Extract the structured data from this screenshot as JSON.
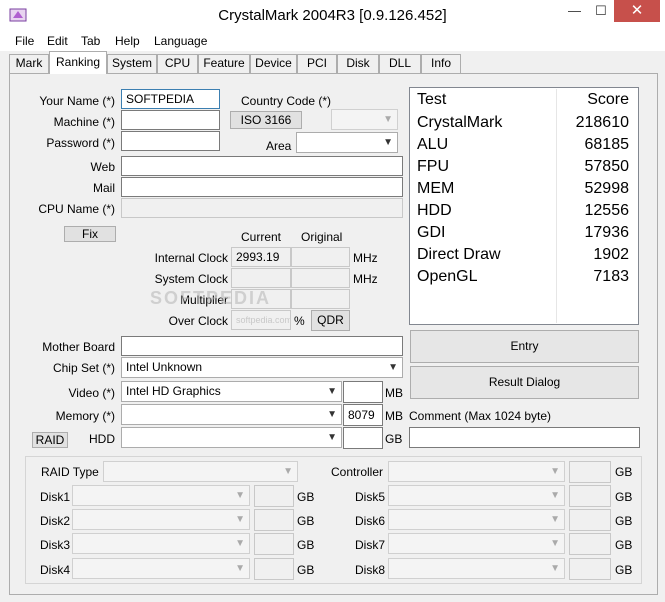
{
  "window": {
    "title": "CrystalMark 2004R3 [0.9.126.452]",
    "min_glyph": "—",
    "max_glyph": "☐",
    "close_glyph": "✕"
  },
  "menu": [
    "File",
    "Edit",
    "Tab",
    "Help",
    "Language"
  ],
  "tabs": [
    "Mark",
    "Ranking",
    "System",
    "CPU",
    "Feature",
    "Device",
    "PCI",
    "Disk",
    "DLL",
    "Info"
  ],
  "active_tab": "Ranking",
  "form": {
    "your_name_label": "Your Name (*)",
    "your_name_value": "SOFTPEDIA",
    "machine_label": "Machine (*)",
    "password_label": "Password (*)",
    "country_code_label": "Country Code (*)",
    "iso_button": "ISO 3166",
    "area_label": "Area",
    "web_label": "Web",
    "mail_label": "Mail",
    "cpu_name_label": "CPU Name (*)",
    "fix_button": "Fix",
    "current_label": "Current",
    "original_label": "Original",
    "internal_clock_label": "Internal Clock",
    "internal_clock_value": "2993.19",
    "system_clock_label": "System Clock",
    "multiplier_label": "Multiplier",
    "over_clock_label": "Over Clock",
    "mhz1": "MHz",
    "mhz2": "MHz",
    "percent": "%",
    "qdr_button": "QDR",
    "mother_board_label": "Mother Board",
    "chip_set_label": "Chip Set (*)",
    "chip_set_value": "Intel Unknown",
    "video_label": "Video (*)",
    "video_value": "Intel HD Graphics",
    "video_unit": "MB",
    "memory_label": "Memory (*)",
    "memory_value": "8079",
    "memory_unit": "MB",
    "raid_button": "RAID",
    "hdd_label": "HDD",
    "hdd_unit": "GB",
    "comment_label": "Comment (Max 1024 byte)"
  },
  "scores": {
    "header_test": "Test",
    "header_score": "Score",
    "rows": [
      {
        "name": "CrystalMark",
        "score": "218610"
      },
      {
        "name": "ALU",
        "score": "68185"
      },
      {
        "name": "FPU",
        "score": "57850"
      },
      {
        "name": "MEM",
        "score": "52998"
      },
      {
        "name": "HDD",
        "score": "12556"
      },
      {
        "name": "GDI",
        "score": "17936"
      },
      {
        "name": "Direct Draw",
        "score": "1902"
      },
      {
        "name": "OpenGL",
        "score": "7183"
      }
    ]
  },
  "actions": {
    "entry_button": "Entry",
    "result_dialog_button": "Result Dialog"
  },
  "raid": {
    "raid_type_label": "RAID Type",
    "controller_label": "Controller",
    "gb": "GB",
    "disks_left": [
      "Disk1",
      "Disk2",
      "Disk3",
      "Disk4"
    ],
    "disks_right": [
      "Disk5",
      "Disk6",
      "Disk7",
      "Disk8"
    ]
  },
  "watermark": "SOFTPEDIA",
  "watermark_small": "softpedia.com"
}
